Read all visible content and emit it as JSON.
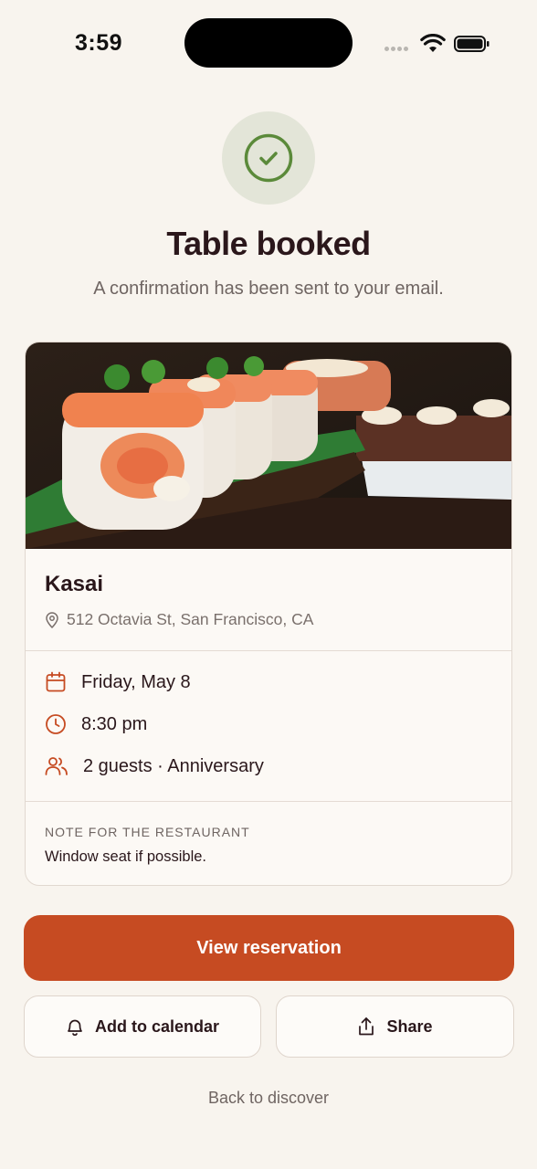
{
  "status_bar": {
    "time": "3:59"
  },
  "header": {
    "title": "Table booked",
    "subtitle": "A confirmation has been sent to your email."
  },
  "restaurant": {
    "name": "Kasai",
    "address": "512 Octavia St, San Francisco, CA"
  },
  "reservation": {
    "date": "Friday, May 8",
    "time": "8:30 pm",
    "guests": "2 guests · Anniversary"
  },
  "note": {
    "label": "NOTE FOR THE RESTAURANT",
    "text": "Window seat if possible."
  },
  "actions": {
    "primary": "View reservation",
    "calendar": "Add to calendar",
    "share": "Share",
    "back": "Back to discover"
  },
  "colors": {
    "accent": "#c64b22",
    "success": "#5b8a3a",
    "background": "#f8f4ee"
  },
  "icons": [
    "check-circle-icon",
    "map-pin-icon",
    "calendar-icon",
    "clock-icon",
    "users-icon",
    "bell-icon",
    "share-icon"
  ]
}
